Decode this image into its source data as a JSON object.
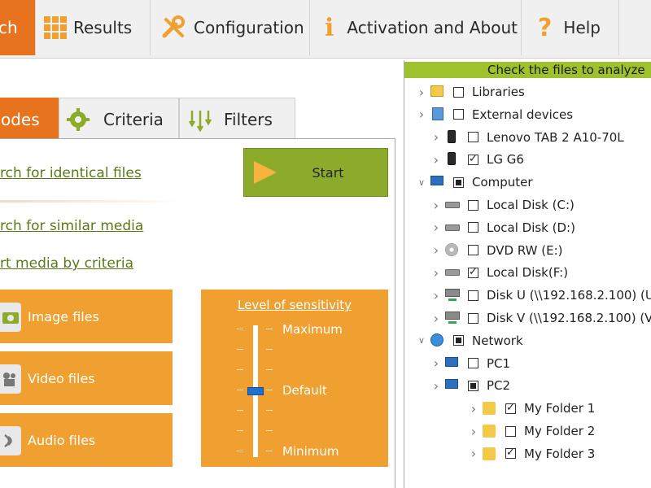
{
  "toolbar": {
    "search_label": "ch",
    "results_label": "Results",
    "config_label": "Configuration",
    "about_label": "Activation and About",
    "help_label": "Help",
    "help_glyph": "?",
    "activation_glyph": "i"
  },
  "subtabs": {
    "modes_label": "odes",
    "criteria_label": "Criteria",
    "filters_label": "Filters"
  },
  "modes": {
    "identical": "rch for identical files",
    "similar": "rch for similar media",
    "criteria": "rt media by criteria"
  },
  "start_label": "Start",
  "file_types": {
    "image": "Image files",
    "video": "Video files",
    "audio": "Audio files"
  },
  "sensitivity": {
    "title": "Level of sensitivity",
    "max": "Maximum",
    "default": "Default",
    "min": "Minimum",
    "level": 0.5
  },
  "tree": {
    "header": "Check the files to analyze",
    "rows": [
      {
        "label": "Libraries",
        "state": "unchecked",
        "depth": 0,
        "icon": "library-icon"
      },
      {
        "label": "External devices",
        "state": "unchecked",
        "depth": 0,
        "icon": "external-devices-icon"
      },
      {
        "label": "Lenovo TAB 2 A10-70L",
        "state": "unchecked",
        "depth": 1,
        "icon": "phone-icon"
      },
      {
        "label": "LG G6",
        "state": "checked",
        "depth": 1,
        "icon": "phone-icon"
      },
      {
        "label": "Computer",
        "state": "partial",
        "depth": 0,
        "icon": "computer-icon"
      },
      {
        "label": "Local Disk (C:)",
        "state": "unchecked",
        "depth": 1,
        "icon": "disk-icon"
      },
      {
        "label": "Local Disk (D:)",
        "state": "unchecked",
        "depth": 1,
        "icon": "disk-icon"
      },
      {
        "label": "DVD RW (E:)",
        "state": "unchecked",
        "depth": 1,
        "icon": "dvd-icon"
      },
      {
        "label": "Local Disk(F:)",
        "state": "checked",
        "depth": 1,
        "icon": "disk-icon"
      },
      {
        "label": "Disk U  (\\\\192.168.2.100) (U",
        "state": "unchecked",
        "depth": 1,
        "icon": "network-drive-icon"
      },
      {
        "label": "Disk V  (\\\\192.168.2.100) (V",
        "state": "unchecked",
        "depth": 1,
        "icon": "network-drive-icon"
      },
      {
        "label": "Network",
        "state": "partial",
        "depth": 0,
        "icon": "network-icon"
      },
      {
        "label": "PC1",
        "state": "unchecked",
        "depth": 1,
        "icon": "pc-icon"
      },
      {
        "label": "PC2",
        "state": "partial",
        "depth": 1,
        "icon": "pc-icon"
      },
      {
        "label": "My Folder 1",
        "state": "checked",
        "depth": 2,
        "icon": "folder-icon"
      },
      {
        "label": "My Folder 2",
        "state": "unchecked",
        "depth": 2,
        "icon": "folder-icon"
      },
      {
        "label": "My Folder 3",
        "state": "checked",
        "depth": 2,
        "icon": "folder-icon"
      }
    ]
  },
  "colors": {
    "accent_orange": "#e8731e",
    "tile_orange": "#f0a030",
    "start_green": "#8cab2a",
    "header_green": "#9ec22e",
    "link_green": "#5a7a16"
  }
}
